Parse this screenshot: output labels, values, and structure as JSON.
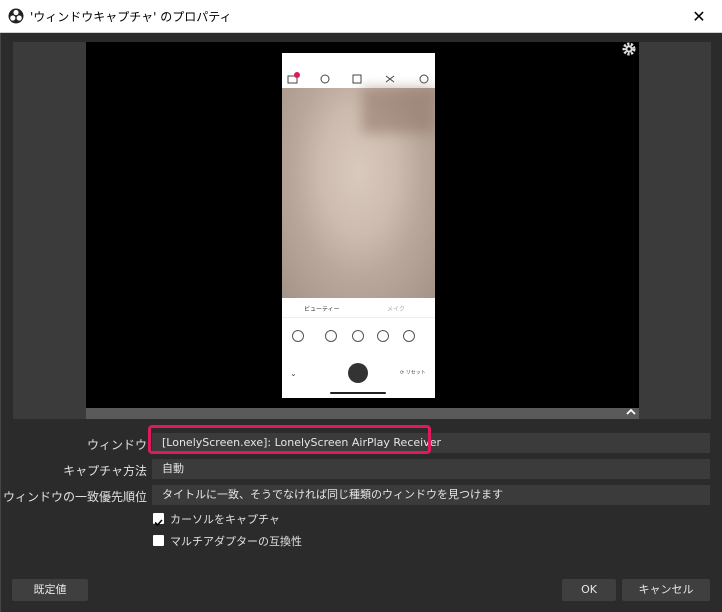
{
  "window": {
    "title": "'ウィンドウキャプチャ' のプロパティ",
    "close_glyph": "✕"
  },
  "preview": {
    "phone": {
      "badge": "1",
      "tab_beauty": "ビューティー",
      "tab_makeup": "メイク",
      "reset_label": "リセット"
    }
  },
  "form": {
    "window_label": "ウィンドウ",
    "window_value": "[LonelyScreen.exe]: LonelyScreen AirPlay Receiver",
    "capture_method_label": "キャプチャ方法",
    "capture_method_value": "自動",
    "priority_label": "ウィンドウの一致優先順位",
    "priority_value": "タイトルに一致、そうでなければ同じ種類のウィンドウを見つけます",
    "capture_cursor_label": "カーソルをキャプチャ",
    "capture_cursor_checked": true,
    "multi_adapter_label": "マルチアダプターの互換性",
    "multi_adapter_checked": false
  },
  "buttons": {
    "defaults": "既定値",
    "ok": "OK",
    "cancel": "キャンセル"
  },
  "colors": {
    "highlight": "#e0185c",
    "background": "#2b2b2b",
    "field_bg": "#3b3b3b"
  }
}
